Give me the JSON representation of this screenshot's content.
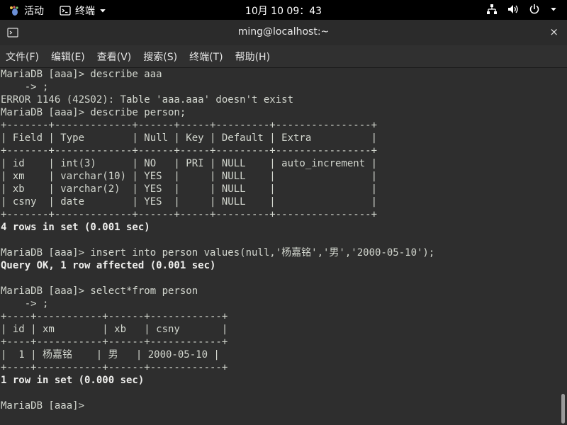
{
  "topbar": {
    "activities": "活动",
    "app_name": "终端",
    "clock": "10月 10  09：43"
  },
  "window": {
    "title": "ming@localhost:~",
    "close_glyph": "×"
  },
  "menu": [
    "文件(F)",
    "编辑(E)",
    "查看(V)",
    "搜索(S)",
    "终端(T)",
    "帮助(H)"
  ],
  "terminal_lines": [
    {
      "text": "MariaDB [aaa]> describe aaa",
      "bold": false
    },
    {
      "text": "    -> ;",
      "bold": false
    },
    {
      "text": "ERROR 1146 (42S02): Table 'aaa.aaa' doesn't exist",
      "bold": false
    },
    {
      "text": "MariaDB [aaa]> describe person;",
      "bold": false
    },
    {
      "text": "+-------+-------------+------+-----+---------+----------------+",
      "bold": false
    },
    {
      "text": "| Field | Type        | Null | Key | Default | Extra          |",
      "bold": false
    },
    {
      "text": "+-------+-------------+------+-----+---------+----------------+",
      "bold": false
    },
    {
      "text": "| id    | int(3)      | NO   | PRI | NULL    | auto_increment |",
      "bold": false
    },
    {
      "text": "| xm    | varchar(10) | YES  |     | NULL    |                |",
      "bold": false
    },
    {
      "text": "| xb    | varchar(2)  | YES  |     | NULL    |                |",
      "bold": false
    },
    {
      "text": "| csny  | date        | YES  |     | NULL    |                |",
      "bold": false
    },
    {
      "text": "+-------+-------------+------+-----+---------+----------------+",
      "bold": false
    },
    {
      "text": "4 rows in set (0.001 sec)",
      "bold": true
    },
    {
      "text": "",
      "bold": false
    },
    {
      "text": "MariaDB [aaa]> insert into person values(null,'杨嘉铭','男','2000-05-10');",
      "bold": false
    },
    {
      "text": "Query OK, 1 row affected (0.001 sec)",
      "bold": true
    },
    {
      "text": "",
      "bold": false
    },
    {
      "text": "MariaDB [aaa]> select*from person",
      "bold": false
    },
    {
      "text": "    -> ;",
      "bold": false
    },
    {
      "text": "+----+-----------+------+------------+",
      "bold": false
    },
    {
      "text": "| id | xm        | xb   | csny       |",
      "bold": false
    },
    {
      "text": "+----+-----------+------+------------+",
      "bold": false
    },
    {
      "text": "|  1 | 杨嘉铭    | 男   | 2000-05-10 |",
      "bold": false
    },
    {
      "text": "+----+-----------+------+------------+",
      "bold": false
    },
    {
      "text": "1 row in set (0.000 sec)",
      "bold": true
    },
    {
      "text": "",
      "bold": false
    },
    {
      "text": "MariaDB [aaa]> ",
      "bold": false
    }
  ],
  "icons": {
    "activities": "gnome-foot-icon",
    "terminal": "terminal-icon",
    "network": "network-icon",
    "volume": "volume-icon",
    "power": "power-icon"
  },
  "colors": {
    "terminal_bg": "#2e2e2e",
    "terminal_fg": "#d3d7cf",
    "topbar_bg": "#000000"
  }
}
